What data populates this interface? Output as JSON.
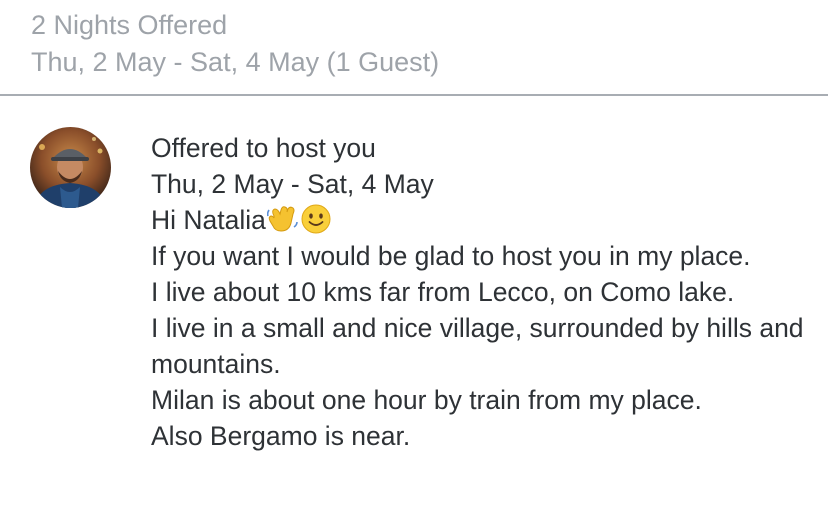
{
  "header": {
    "title": "2 Nights Offered",
    "dates": "Thu, 2 May - Sat, 4 May (1 Guest)"
  },
  "offer": {
    "avatar_icon": "host-avatar",
    "status": "Offered to host you",
    "dates": "Thu, 2 May - Sat, 4 May",
    "greeting": "Hi Natalia",
    "greeting_emojis": [
      "waving-hand-emoji",
      "slightly-smiling-face-emoji"
    ],
    "body_lines": [
      "If you want I would be glad to host you in my place.",
      "I live about 10 kms far from Lecco, on Como lake.",
      "I live in a small and nice village, surrounded by hills and mountains.",
      "Milan is about one hour by train from my place.",
      "Also Bergamo is near."
    ]
  },
  "colors": {
    "header_text": "#9ea3a9",
    "body_text": "#2e3236",
    "divider": "#a8adb3"
  }
}
